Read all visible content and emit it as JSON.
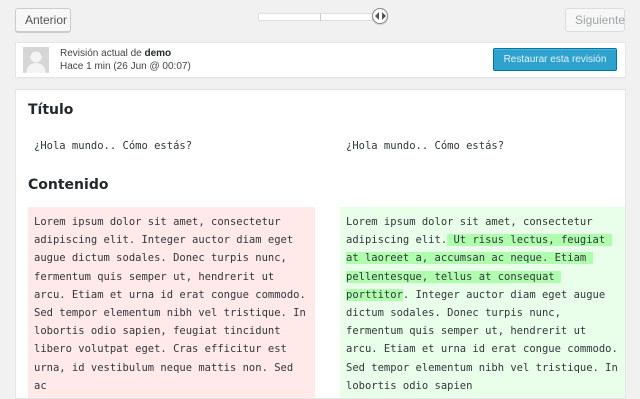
{
  "nav": {
    "prev_label": "Anterior",
    "next_label": "Siguiente"
  },
  "revision": {
    "line1_prefix": "Revisión actual de ",
    "author": "demo",
    "line2": "Hace 1 min (26 Jun @ 00:07)",
    "restore_label": "Restaurar esta revisión"
  },
  "diff": {
    "title_heading": "Título",
    "title_old": "¿Hola mundo.. Cómo estás?",
    "title_new": "¿Hola mundo.. Cómo estás?",
    "content_heading": "Contenido",
    "content_old": "Lorem ipsum dolor sit amet, consectetur adipiscing elit. Integer auctor diam eget augue dictum sodales. Donec turpis nunc, fermentum quis semper ut, hendrerit ut arcu. Etiam et urna id erat congue commodo. Sed tempor elementum nibh vel tristique. In lobortis odio sapien, feugiat tincidunt libero volutpat eget. Cras efficitur est urna, id vestibulum neque mattis non. Sed ac",
    "content_new_before": "Lorem ipsum dolor sit amet, consectetur adipiscing elit.",
    "content_new_inserted": " Ut risus lectus, feugiat at laoreet a, accumsan ac neque. Etiam pellentesque, tellus at consequat porttitor",
    "content_new_after": ". Integer auctor diam eget augue dictum sodales. Donec turpis nunc, fermentum quis semper ut, hendrerit ut arcu. Etiam et urna id erat congue commodo. Sed tempor elementum nibh vel tristique. In lobortis odio sapien"
  },
  "colors": {
    "deleted_bg": "#ffe9e9",
    "added_bg": "#e9ffe9",
    "inserted_highlight": "#afffaf",
    "primary_button": "#2ea2cc"
  }
}
